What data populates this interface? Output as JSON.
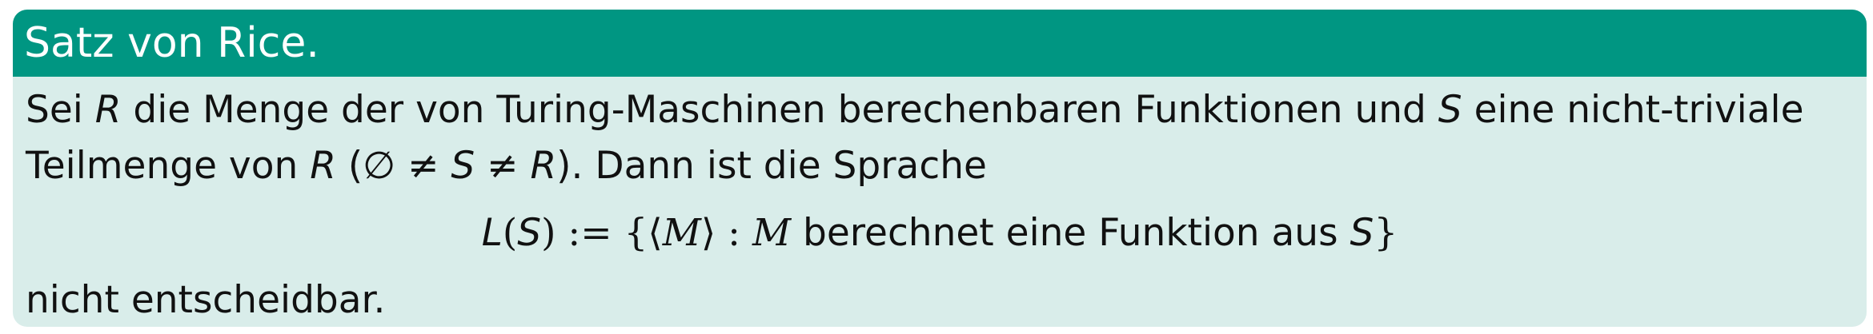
{
  "theorem": {
    "title": "Satz von Rice.",
    "line1": {
      "t1": "Sei ",
      "var_R": "R",
      "t2": " die Menge der von Turing-Maschinen berechenbaren Funktionen und ",
      "var_S": "S",
      "t3": " eine nicht-triviale"
    },
    "line2": {
      "t1": "Teilmenge von ",
      "var_R": "R",
      "t2": " (∅ ≠ ",
      "var_S": "S",
      "t3": " ≠ ",
      "var_R2": "R",
      "t4": "). Dann ist die Sprache"
    },
    "formula": {
      "L": "L",
      "open": "(",
      "S1": "S",
      "close_def": ") := {⟨",
      "M1": "M",
      "mid": "⟩ : ",
      "M2": "M",
      "text": " berechnet eine Funktion aus ",
      "S2": "S",
      "end": "}"
    },
    "line4": "nicht entscheidbar."
  }
}
